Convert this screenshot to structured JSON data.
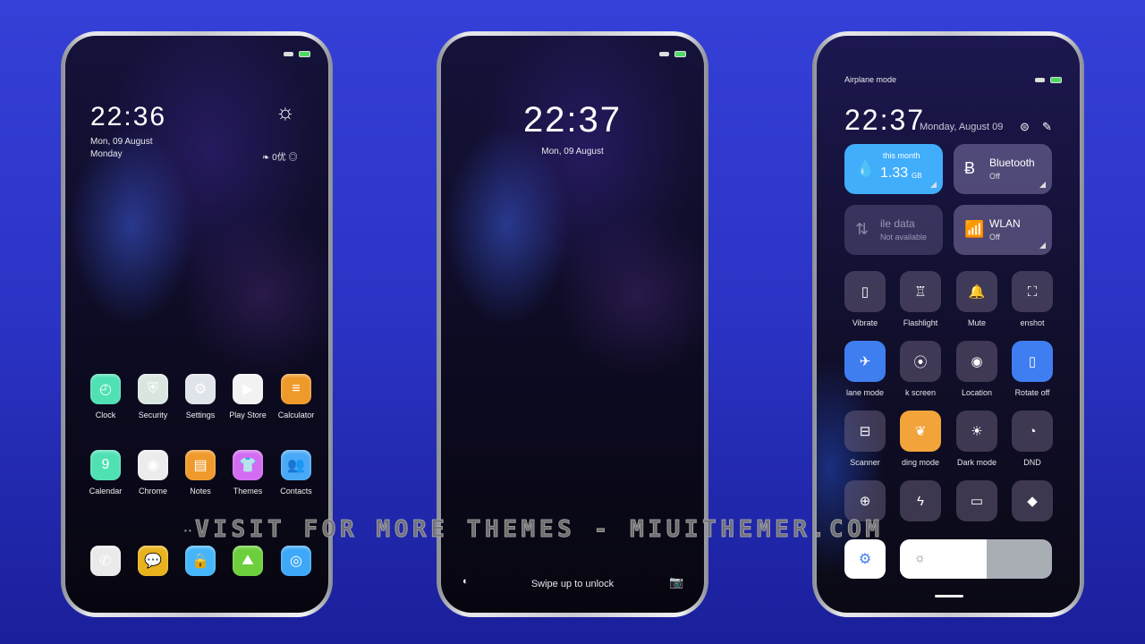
{
  "colors": {
    "accent_blue": "#3f7ef0",
    "data_tile": "#41aefb",
    "reading_mode": "#f2a33a",
    "background": "#2f3acf"
  },
  "home": {
    "time": "22:36",
    "date": "Mon, 09 August",
    "weekday": "Monday",
    "weather_icon": "sun-icon",
    "aqi": "0优",
    "apps": [
      {
        "label": "Clock",
        "color": "#4fe0b4",
        "icon": "◴"
      },
      {
        "label": "Security",
        "color": "#d9e6e0",
        "icon": "⛨"
      },
      {
        "label": "Settings",
        "color": "#dfe3ea",
        "icon": "⚙"
      },
      {
        "label": "Play Store",
        "color": "#f2f2f2",
        "icon": "▶"
      },
      {
        "label": "Calculator",
        "color": "#ee9a2a",
        "icon": "≡"
      },
      {
        "label": "Calendar",
        "color": "#4fe0b4",
        "icon": "9"
      },
      {
        "label": "Chrome",
        "color": "#ececec",
        "icon": "◉"
      },
      {
        "label": "Notes",
        "color": "#ef9a2a",
        "icon": "▤"
      },
      {
        "label": "Themes",
        "color": "#d36cf0",
        "icon": "👕"
      },
      {
        "label": "Contacts",
        "color": "#4aa9f7",
        "icon": "👥"
      }
    ],
    "dock": [
      {
        "name": "phone",
        "color": "#eaeaea",
        "icon": "✆"
      },
      {
        "name": "messages",
        "color": "#e8b21c",
        "icon": "💬"
      },
      {
        "name": "store",
        "color": "#45b6fb",
        "icon": "🔒"
      },
      {
        "name": "gallery",
        "color": "#6ccf3b",
        "icon": "⛰"
      },
      {
        "name": "camera",
        "color": "#3ea8f8",
        "icon": "◎"
      }
    ]
  },
  "lock": {
    "time": "22:37",
    "date": "Mon, 09 August",
    "hint": "Swipe up to unlock"
  },
  "control": {
    "status_label": "Airplane mode",
    "time": "22:37",
    "date": "Monday, August 09",
    "data_tile": {
      "label": "this month",
      "value": "1.33",
      "unit": "GB"
    },
    "bluetooth": {
      "title": "Bluetooth",
      "state": "Off"
    },
    "mobile_data": {
      "title": "ile data",
      "state": "Not available"
    },
    "wlan": {
      "title": "WLAN",
      "state": "Off"
    },
    "tiles": [
      {
        "label": "Vibrate",
        "icon": "▯",
        "on": false
      },
      {
        "label": "Flashlight",
        "icon": "♖",
        "on": false
      },
      {
        "label": "Mute",
        "icon": "🔔",
        "on": false
      },
      {
        "label": "enshot",
        "icon": "⛶",
        "on": false
      },
      {
        "label": "lane mode",
        "icon": "✈",
        "on": true
      },
      {
        "label": "k screen",
        "icon": "⦿",
        "on": false
      },
      {
        "label": "Location",
        "icon": "◉",
        "on": false
      },
      {
        "label": "Rotate off",
        "icon": "▯",
        "on": true
      },
      {
        "label": "Scanner",
        "icon": "⊟",
        "on": false
      },
      {
        "label": "ding mode",
        "icon": "❦",
        "on": "orange"
      },
      {
        "label": "Dark mode",
        "icon": "☀",
        "on": false
      },
      {
        "label": "DND",
        "icon": "◔",
        "on": false
      },
      {
        "label": "",
        "icon": "⊕",
        "on": false
      },
      {
        "label": "",
        "icon": "ϟ",
        "on": false
      },
      {
        "label": "",
        "icon": "▭",
        "on": false
      },
      {
        "label": "",
        "icon": "◆",
        "on": false
      }
    ],
    "brightness_percent": 57
  },
  "watermark": "VISIT FOR MORE THEMES - MIUITHEMER.COM"
}
